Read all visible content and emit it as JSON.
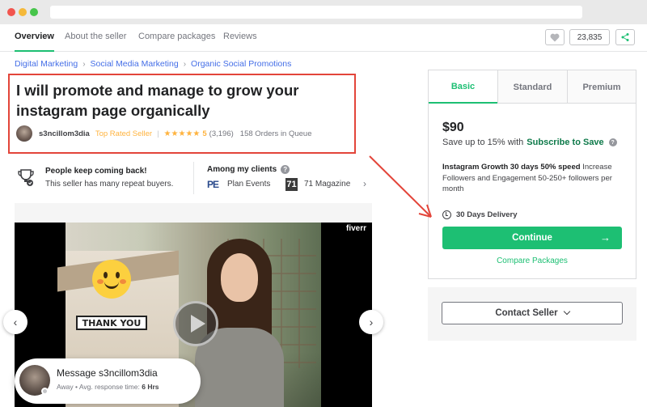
{
  "nav": {
    "tabs": [
      "Overview",
      "About the seller",
      "Compare packages",
      "Reviews"
    ],
    "save_count": "23,835"
  },
  "breadcrumb": [
    "Digital Marketing",
    "Social Media Marketing",
    "Organic Social Promotions"
  ],
  "gig": {
    "title": "I will promote and manage to grow your instagram page organically",
    "seller_name": "s3ncillom3dia",
    "badge": "Top Rated Seller",
    "rating": "5",
    "reviews": "(3,196)",
    "queue": "158 Orders in Queue"
  },
  "info": {
    "repeat_title": "People keep coming back!",
    "repeat_sub": "This seller has many repeat buyers.",
    "clients_title": "Among my clients",
    "clients": [
      {
        "logo": "PE",
        "name": "Plan Events"
      },
      {
        "logo": "71",
        "name": "71 Magazine"
      }
    ]
  },
  "video": {
    "watermark": "fiverr",
    "caption": "THANK YOU"
  },
  "message": {
    "title": "Message s3ncillom3dia",
    "status": "Away",
    "response_label": "Avg. response time:",
    "response_value": "6 Hrs"
  },
  "package": {
    "tabs": [
      "Basic",
      "Standard",
      "Premium"
    ],
    "price": "$90",
    "save_prefix": "Save up to 15% with",
    "save_link": "Subscribe to Save",
    "desc_bold": "Instagram Growth 30 days 50% speed",
    "desc_rest": " Increase Followers and Engagement 50-250+ followers per month",
    "delivery": "30 Days Delivery",
    "continue_label": "Continue",
    "compare_label": "Compare Packages"
  },
  "contact": {
    "label": "Contact Seller"
  },
  "colors": {
    "accent": "#1dbf73",
    "link": "#446ee7",
    "star": "#ffb33e",
    "highlight": "#e3453a"
  }
}
